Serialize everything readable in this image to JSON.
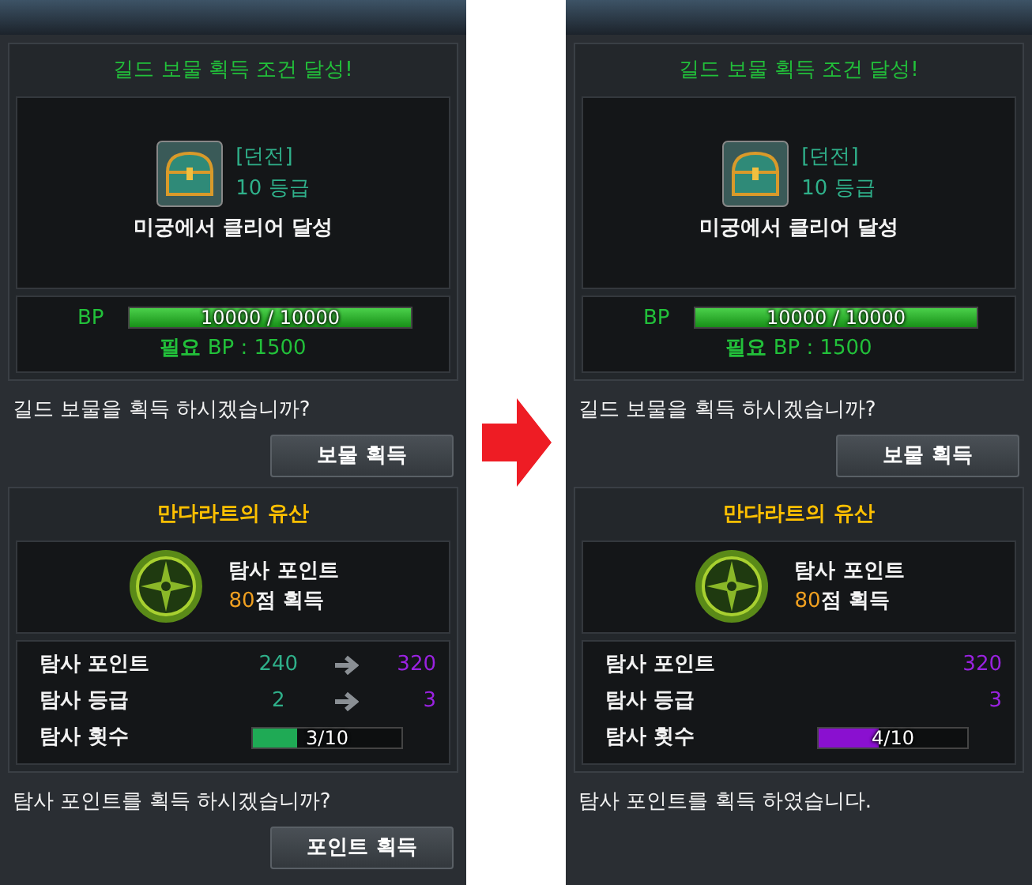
{
  "panels": [
    {
      "treasure": {
        "title": "길드 보물 획득 조건 달성!",
        "category": "[던전]",
        "grade": "10 등급",
        "condition": "미궁에서 클리어 달성",
        "bp": {
          "label": "BP",
          "reading": "10000 / 10000",
          "level": 1
        },
        "required_label": "필요",
        "required_value": "BP : 1500"
      },
      "treasure_question": "길드 보물을 획득 하시겠습니까?",
      "treasure_button": "보물 획득",
      "legacy": {
        "title": "만다라트의 유산",
        "reward_name": "탐사 포인트",
        "reward_points": "80",
        "reward_suffix": "점 획득",
        "stats": [
          {
            "label": "탐사 포인트",
            "old": "240",
            "new": "320"
          },
          {
            "label": "탐사 등급",
            "old": "2",
            "new": "3"
          }
        ],
        "count": {
          "label": "탐사 횟수",
          "reading": "3/10",
          "level": 0.3,
          "color": "#1faa55"
        }
      },
      "legacy_message": "탐사 포인트를 획득 하시겠습니까?",
      "legacy_button": "포인트 획득"
    },
    {
      "treasure": {
        "title": "길드 보물 획득 조건 달성!",
        "category": "[던전]",
        "grade": "10 등급",
        "condition": "미궁에서 클리어 달성",
        "bp": {
          "label": "BP",
          "reading": "10000 / 10000",
          "level": 1
        },
        "required_label": "필요",
        "required_value": "BP : 1500"
      },
      "treasure_question": "길드 보물을 획득 하시겠습니까?",
      "treasure_button": "보물 획득",
      "legacy": {
        "title": "만다라트의 유산",
        "reward_name": "탐사 포인트",
        "reward_points": "80",
        "reward_suffix": "점 획득",
        "stats": [
          {
            "label": "탐사 포인트",
            "new": "320"
          },
          {
            "label": "탐사 등급",
            "new": "3"
          }
        ],
        "count": {
          "label": "탐사 횟수",
          "reading": "4/10",
          "level": 0.4,
          "color": "#8a10d0"
        }
      },
      "legacy_message": "탐사 포인트를 획득 하였습니다."
    }
  ]
}
